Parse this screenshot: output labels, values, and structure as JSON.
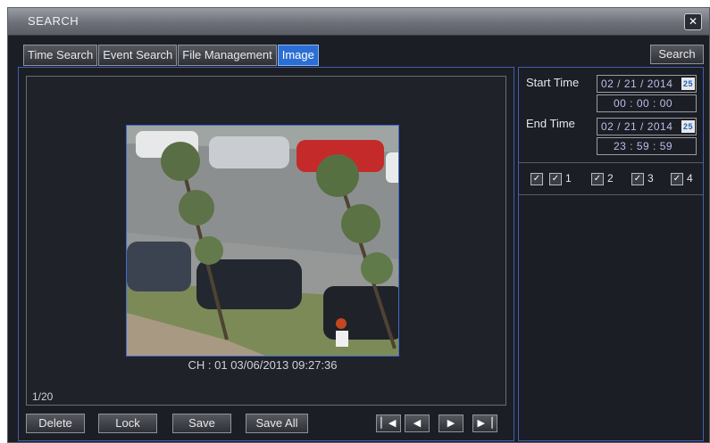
{
  "window": {
    "title": "SEARCH",
    "close_icon": "close-icon"
  },
  "tabs": [
    {
      "label": "Time Search",
      "active": false
    },
    {
      "label": "Event Search",
      "active": false
    },
    {
      "label": "File Management",
      "active": false
    },
    {
      "label": "Image",
      "active": true
    }
  ],
  "search_button": "Search",
  "viewer": {
    "caption": "CH : 01  03/06/2013 09:27:36",
    "counter": "1/20"
  },
  "actions": {
    "delete": "Delete",
    "lock": "Lock",
    "save": "Save",
    "save_all": "Save All"
  },
  "navigation": {
    "first": "first-icon",
    "prev": "prev-icon",
    "next": "next-icon",
    "last": "last-icon"
  },
  "search_panel": {
    "start_time_label": "Start Time",
    "start_date": "02 / 21 / 2014",
    "start_time": "00  :  00  :  00",
    "end_time_label": "End Time",
    "end_date": "02 / 21 / 2014",
    "end_time": "23  :  59  :  59",
    "calendar_icon_text": "25",
    "channels": [
      {
        "label": "",
        "checked": true
      },
      {
        "label": "1",
        "checked": true
      },
      {
        "label": "2",
        "checked": true
      },
      {
        "label": "3",
        "checked": true
      },
      {
        "label": "4",
        "checked": true
      }
    ]
  },
  "colors": {
    "accent": "#2c6fd4",
    "panel_border": "#3f5fb0",
    "background": "#1c1e25"
  }
}
